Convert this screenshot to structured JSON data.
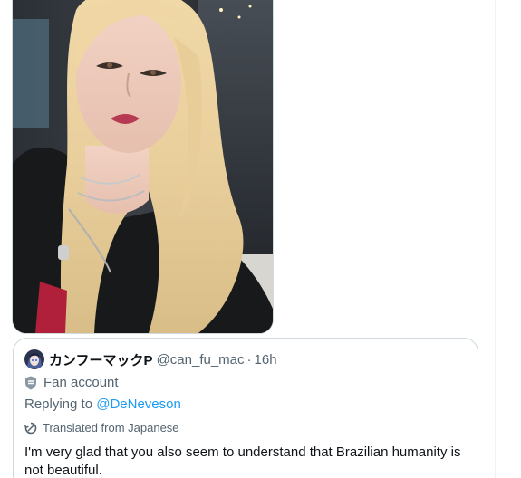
{
  "quoted_tweet": {
    "display_name": "カンフーマックP",
    "handle": "@can_fu_mac",
    "separator": "·",
    "time": "16h",
    "label": "Fan account",
    "replying_prefix": "Replying to ",
    "replying_to": "@DeNeveson",
    "translated_label": "Translated from Japanese",
    "text": "I'm very glad that you also seem to understand that Brazilian humanity is not beautiful."
  },
  "icons": {
    "label_icon": "shield-icon",
    "translate_icon": "translate-icon"
  },
  "colors": {
    "link": "#1d9bf0",
    "secondary_text": "#536471",
    "primary_text": "#0f1419",
    "border": "#cfd9de"
  }
}
